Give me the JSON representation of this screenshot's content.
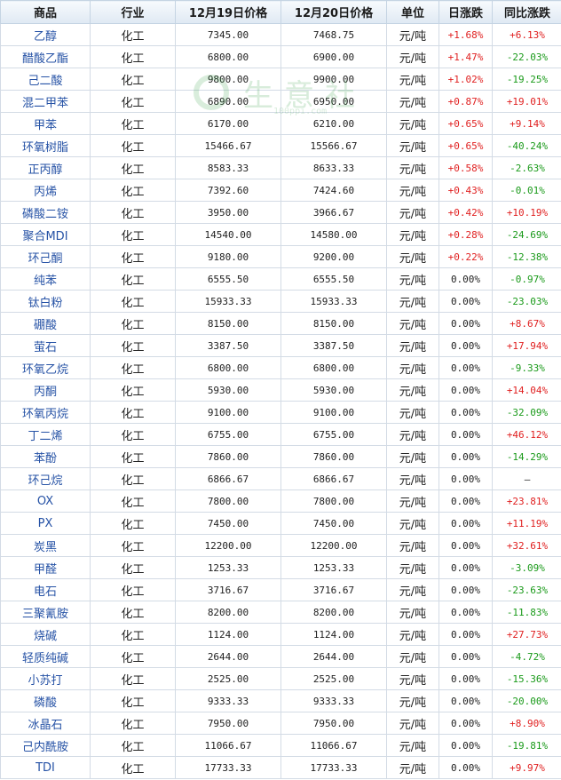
{
  "headers": [
    "商品",
    "行业",
    "12月19日价格",
    "12月20日价格",
    "单位",
    "日涨跌",
    "同比涨跌"
  ],
  "watermark": {
    "text": "生意社",
    "url": "100ppi.com"
  },
  "colors": {
    "up": "#e02020",
    "down": "#1a9a1a",
    "name_link": "#2753a6",
    "header_bg": "#dfe9f3"
  },
  "rows": [
    {
      "name": "乙醇",
      "industry": "化工",
      "price_19": "7345.00",
      "price_20": "7468.75",
      "unit": "元/吨",
      "daily": "+1.68%",
      "yoy": "+6.13%"
    },
    {
      "name": "醋酸乙酯",
      "industry": "化工",
      "price_19": "6800.00",
      "price_20": "6900.00",
      "unit": "元/吨",
      "daily": "+1.47%",
      "yoy": "-22.03%"
    },
    {
      "name": "己二酸",
      "industry": "化工",
      "price_19": "9800.00",
      "price_20": "9900.00",
      "unit": "元/吨",
      "daily": "+1.02%",
      "yoy": "-19.25%"
    },
    {
      "name": "混二甲苯",
      "industry": "化工",
      "price_19": "6890.00",
      "price_20": "6950.00",
      "unit": "元/吨",
      "daily": "+0.87%",
      "yoy": "+19.01%"
    },
    {
      "name": "甲苯",
      "industry": "化工",
      "price_19": "6170.00",
      "price_20": "6210.00",
      "unit": "元/吨",
      "daily": "+0.65%",
      "yoy": "+9.14%"
    },
    {
      "name": "环氧树脂",
      "industry": "化工",
      "price_19": "15466.67",
      "price_20": "15566.67",
      "unit": "元/吨",
      "daily": "+0.65%",
      "yoy": "-40.24%"
    },
    {
      "name": "正丙醇",
      "industry": "化工",
      "price_19": "8583.33",
      "price_20": "8633.33",
      "unit": "元/吨",
      "daily": "+0.58%",
      "yoy": "-2.63%"
    },
    {
      "name": "丙烯",
      "industry": "化工",
      "price_19": "7392.60",
      "price_20": "7424.60",
      "unit": "元/吨",
      "daily": "+0.43%",
      "yoy": "-0.01%"
    },
    {
      "name": "磷酸二铵",
      "industry": "化工",
      "price_19": "3950.00",
      "price_20": "3966.67",
      "unit": "元/吨",
      "daily": "+0.42%",
      "yoy": "+10.19%"
    },
    {
      "name": "聚合MDI",
      "industry": "化工",
      "price_19": "14540.00",
      "price_20": "14580.00",
      "unit": "元/吨",
      "daily": "+0.28%",
      "yoy": "-24.69%"
    },
    {
      "name": "环己酮",
      "industry": "化工",
      "price_19": "9180.00",
      "price_20": "9200.00",
      "unit": "元/吨",
      "daily": "+0.22%",
      "yoy": "-12.38%"
    },
    {
      "name": "纯苯",
      "industry": "化工",
      "price_19": "6555.50",
      "price_20": "6555.50",
      "unit": "元/吨",
      "daily": "0.00%",
      "yoy": "-0.97%"
    },
    {
      "name": "钛白粉",
      "industry": "化工",
      "price_19": "15933.33",
      "price_20": "15933.33",
      "unit": "元/吨",
      "daily": "0.00%",
      "yoy": "-23.03%"
    },
    {
      "name": "硼酸",
      "industry": "化工",
      "price_19": "8150.00",
      "price_20": "8150.00",
      "unit": "元/吨",
      "daily": "0.00%",
      "yoy": "+8.67%"
    },
    {
      "name": "萤石",
      "industry": "化工",
      "price_19": "3387.50",
      "price_20": "3387.50",
      "unit": "元/吨",
      "daily": "0.00%",
      "yoy": "+17.94%"
    },
    {
      "name": "环氧乙烷",
      "industry": "化工",
      "price_19": "6800.00",
      "price_20": "6800.00",
      "unit": "元/吨",
      "daily": "0.00%",
      "yoy": "-9.33%"
    },
    {
      "name": "丙酮",
      "industry": "化工",
      "price_19": "5930.00",
      "price_20": "5930.00",
      "unit": "元/吨",
      "daily": "0.00%",
      "yoy": "+14.04%"
    },
    {
      "name": "环氧丙烷",
      "industry": "化工",
      "price_19": "9100.00",
      "price_20": "9100.00",
      "unit": "元/吨",
      "daily": "0.00%",
      "yoy": "-32.09%"
    },
    {
      "name": "丁二烯",
      "industry": "化工",
      "price_19": "6755.00",
      "price_20": "6755.00",
      "unit": "元/吨",
      "daily": "0.00%",
      "yoy": "+46.12%"
    },
    {
      "name": "苯酚",
      "industry": "化工",
      "price_19": "7860.00",
      "price_20": "7860.00",
      "unit": "元/吨",
      "daily": "0.00%",
      "yoy": "-14.29%"
    },
    {
      "name": "环己烷",
      "industry": "化工",
      "price_19": "6866.67",
      "price_20": "6866.67",
      "unit": "元/吨",
      "daily": "0.00%",
      "yoy": "—"
    },
    {
      "name": "OX",
      "industry": "化工",
      "price_19": "7800.00",
      "price_20": "7800.00",
      "unit": "元/吨",
      "daily": "0.00%",
      "yoy": "+23.81%"
    },
    {
      "name": "PX",
      "industry": "化工",
      "price_19": "7450.00",
      "price_20": "7450.00",
      "unit": "元/吨",
      "daily": "0.00%",
      "yoy": "+11.19%"
    },
    {
      "name": "炭黑",
      "industry": "化工",
      "price_19": "12200.00",
      "price_20": "12200.00",
      "unit": "元/吨",
      "daily": "0.00%",
      "yoy": "+32.61%"
    },
    {
      "name": "甲醛",
      "industry": "化工",
      "price_19": "1253.33",
      "price_20": "1253.33",
      "unit": "元/吨",
      "daily": "0.00%",
      "yoy": "-3.09%"
    },
    {
      "name": "电石",
      "industry": "化工",
      "price_19": "3716.67",
      "price_20": "3716.67",
      "unit": "元/吨",
      "daily": "0.00%",
      "yoy": "-23.63%"
    },
    {
      "name": "三聚氰胺",
      "industry": "化工",
      "price_19": "8200.00",
      "price_20": "8200.00",
      "unit": "元/吨",
      "daily": "0.00%",
      "yoy": "-11.83%"
    },
    {
      "name": "烧碱",
      "industry": "化工",
      "price_19": "1124.00",
      "price_20": "1124.00",
      "unit": "元/吨",
      "daily": "0.00%",
      "yoy": "+27.73%"
    },
    {
      "name": "轻质纯碱",
      "industry": "化工",
      "price_19": "2644.00",
      "price_20": "2644.00",
      "unit": "元/吨",
      "daily": "0.00%",
      "yoy": "-4.72%"
    },
    {
      "name": "小苏打",
      "industry": "化工",
      "price_19": "2525.00",
      "price_20": "2525.00",
      "unit": "元/吨",
      "daily": "0.00%",
      "yoy": "-15.36%"
    },
    {
      "name": "磷酸",
      "industry": "化工",
      "price_19": "9333.33",
      "price_20": "9333.33",
      "unit": "元/吨",
      "daily": "0.00%",
      "yoy": "-20.00%"
    },
    {
      "name": "冰晶石",
      "industry": "化工",
      "price_19": "7950.00",
      "price_20": "7950.00",
      "unit": "元/吨",
      "daily": "0.00%",
      "yoy": "+8.90%"
    },
    {
      "name": "己内酰胺",
      "industry": "化工",
      "price_19": "11066.67",
      "price_20": "11066.67",
      "unit": "元/吨",
      "daily": "0.00%",
      "yoy": "-19.81%"
    },
    {
      "name": "TDI",
      "industry": "化工",
      "price_19": "17733.33",
      "price_20": "17733.33",
      "unit": "元/吨",
      "daily": "0.00%",
      "yoy": "+9.97%"
    }
  ]
}
